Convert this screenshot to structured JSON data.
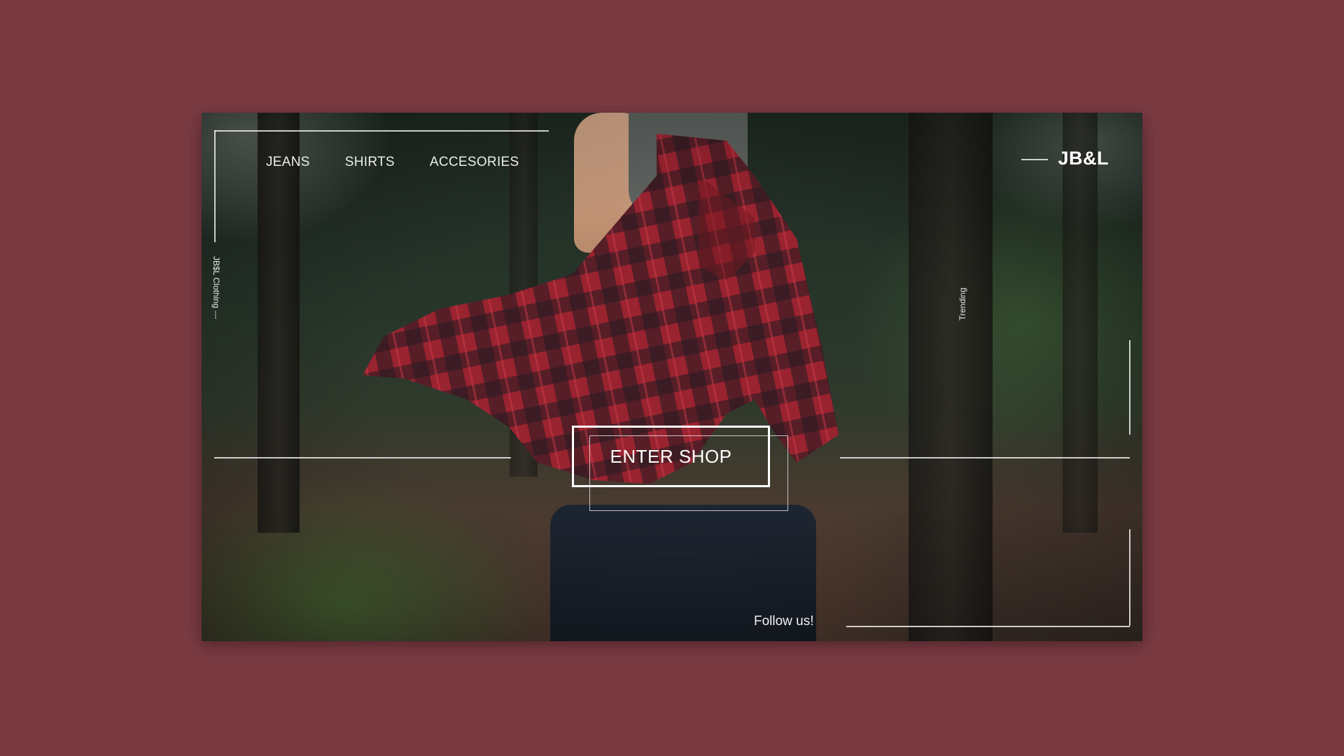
{
  "nav": {
    "items": [
      {
        "label": "JEANS"
      },
      {
        "label": "SHIRTS"
      },
      {
        "label": "ACCESORIES"
      }
    ]
  },
  "brand": {
    "logo": "JB&L",
    "side_label": "JB$L Clothing ---"
  },
  "side": {
    "trending": "Trending"
  },
  "cta": {
    "enter_shop": "ENTER SHOP"
  },
  "footer": {
    "follow": "Follow us!"
  },
  "colors": {
    "page_background": "#7a3a42",
    "text": "#ffffff",
    "shirt_red": "#8e1f2a"
  }
}
